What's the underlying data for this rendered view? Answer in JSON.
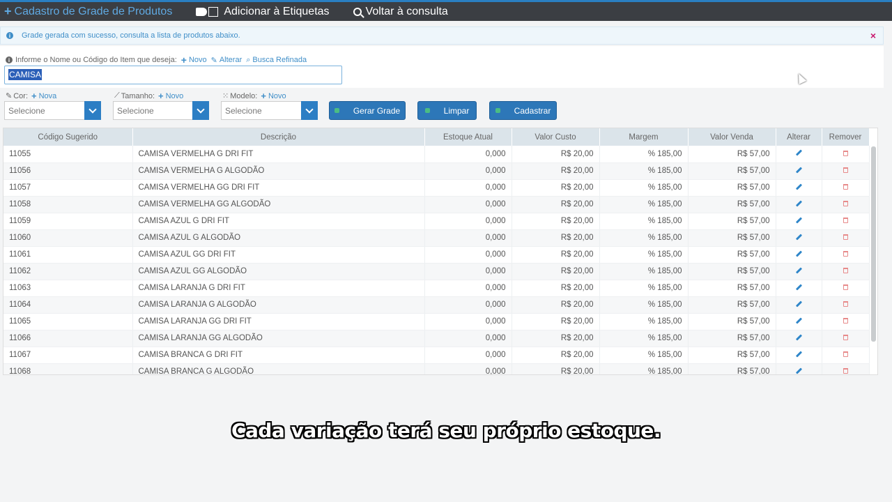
{
  "topbar": {
    "title": "Cadastro de Grade de Produtos",
    "add_labels": "Adicionar à Etiquetas",
    "back_query": "Voltar à consulta"
  },
  "alert": {
    "message": "Grade gerada com sucesso, consulta a lista de produtos abaixo.",
    "close": "×"
  },
  "search": {
    "label": "Informe o Nome ou Código do Item que deseja:",
    "new_link": "Novo",
    "edit_link": "Alterar",
    "refined_link": "Busca Refinada",
    "value": "CAMISA"
  },
  "filters": {
    "color": {
      "label": "Cor:",
      "new_link": "Nova",
      "value": "Selecione"
    },
    "size": {
      "label": "Tamanho:",
      "new_link": "Novo",
      "value": "Selecione"
    },
    "model": {
      "label": "Modelo:",
      "new_link": "Novo",
      "value": "Selecione"
    }
  },
  "buttons": {
    "generate": "Gerar Grade",
    "clear": "Limpar",
    "register": "Cadastrar"
  },
  "table": {
    "headers": [
      "Código Sugerido",
      "Descrição",
      "Estoque Atual",
      "Valor Custo",
      "Margem",
      "Valor Venda",
      "Alterar",
      "Remover"
    ],
    "rows": [
      {
        "code": "11055",
        "desc": "CAMISA VERMELHA G DRI FIT",
        "stock": "0,000",
        "cost": "R$ 20,00",
        "margin": "% 185,00",
        "price": "R$ 57,00"
      },
      {
        "code": "11056",
        "desc": "CAMISA VERMELHA G ALGODÃO",
        "stock": "0,000",
        "cost": "R$ 20,00",
        "margin": "% 185,00",
        "price": "R$ 57,00"
      },
      {
        "code": "11057",
        "desc": "CAMISA VERMELHA GG DRI FIT",
        "stock": "0,000",
        "cost": "R$ 20,00",
        "margin": "% 185,00",
        "price": "R$ 57,00"
      },
      {
        "code": "11058",
        "desc": "CAMISA VERMELHA GG ALGODÃO",
        "stock": "0,000",
        "cost": "R$ 20,00",
        "margin": "% 185,00",
        "price": "R$ 57,00"
      },
      {
        "code": "11059",
        "desc": "CAMISA AZUL G DRI FIT",
        "stock": "0,000",
        "cost": "R$ 20,00",
        "margin": "% 185,00",
        "price": "R$ 57,00"
      },
      {
        "code": "11060",
        "desc": "CAMISA AZUL G ALGODÃO",
        "stock": "0,000",
        "cost": "R$ 20,00",
        "margin": "% 185,00",
        "price": "R$ 57,00"
      },
      {
        "code": "11061",
        "desc": "CAMISA AZUL GG DRI FIT",
        "stock": "0,000",
        "cost": "R$ 20,00",
        "margin": "% 185,00",
        "price": "R$ 57,00"
      },
      {
        "code": "11062",
        "desc": "CAMISA AZUL GG ALGODÃO",
        "stock": "0,000",
        "cost": "R$ 20,00",
        "margin": "% 185,00",
        "price": "R$ 57,00"
      },
      {
        "code": "11063",
        "desc": "CAMISA LARANJA G DRI FIT",
        "stock": "0,000",
        "cost": "R$ 20,00",
        "margin": "% 185,00",
        "price": "R$ 57,00"
      },
      {
        "code": "11064",
        "desc": "CAMISA LARANJA G ALGODÃO",
        "stock": "0,000",
        "cost": "R$ 20,00",
        "margin": "% 185,00",
        "price": "R$ 57,00"
      },
      {
        "code": "11065",
        "desc": "CAMISA LARANJA GG DRI FIT",
        "stock": "0,000",
        "cost": "R$ 20,00",
        "margin": "% 185,00",
        "price": "R$ 57,00"
      },
      {
        "code": "11066",
        "desc": "CAMISA LARANJA GG ALGODÃO",
        "stock": "0,000",
        "cost": "R$ 20,00",
        "margin": "% 185,00",
        "price": "R$ 57,00"
      },
      {
        "code": "11067",
        "desc": "CAMISA BRANCA G DRI FIT",
        "stock": "0,000",
        "cost": "R$ 20,00",
        "margin": "% 185,00",
        "price": "R$ 57,00"
      },
      {
        "code": "11068",
        "desc": "CAMISA BRANCA G ALGODÃO",
        "stock": "0,000",
        "cost": "R$ 20,00",
        "margin": "% 185,00",
        "price": "R$ 57,00"
      }
    ]
  },
  "subtitle": "Cada variação terá seu próprio estoque.",
  "colors": {
    "accent": "#2d77b8",
    "topbar": "#3b3e43",
    "alert_text": "#3f8ec8",
    "delete": "#e78a8a"
  }
}
